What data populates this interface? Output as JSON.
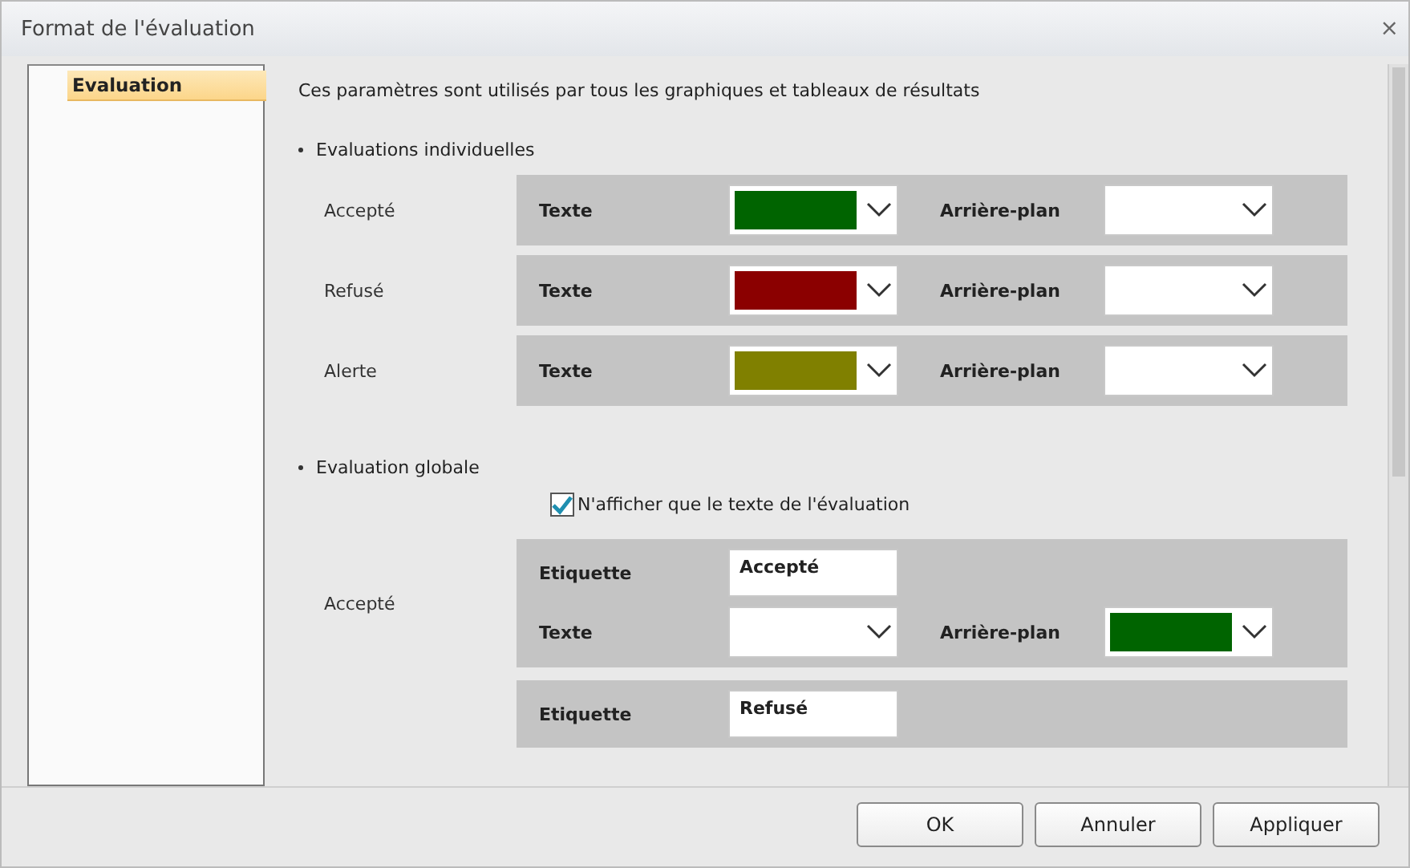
{
  "window": {
    "title": "Format de l'évaluation",
    "close": "×"
  },
  "sidebar": {
    "items": [
      {
        "label": "Evaluation",
        "selected": true
      }
    ]
  },
  "intro": "Ces paramètres sont utilisés par tous les graphiques et tableaux de résultats",
  "individual": {
    "heading": "Evaluations individuelles",
    "rows": [
      {
        "label": "Accepté",
        "text_label": "Texte",
        "text_picker": {
          "color": "#006400"
        },
        "background_label": "Arrière-plan",
        "background_picker": {
          "color": "#ffffff"
        }
      },
      {
        "label": "Refusé",
        "text_label": "Texte",
        "text_picker": {
          "color": "#8b0000"
        },
        "background_label": "Arrière-plan",
        "background_picker": {
          "color": "#ffffff"
        }
      },
      {
        "label": "Alerte",
        "text_label": "Texte",
        "text_picker": {
          "color": "#808000"
        },
        "background_label": "Arrière-plan",
        "background_picker": {
          "color": "#ffffff"
        }
      }
    ]
  },
  "global": {
    "heading": "Evaluation globale",
    "checkbox": {
      "label": "N'afficher que le texte de l'évaluation",
      "checked": true
    },
    "groups": [
      {
        "label": "Accepté",
        "etiquette_label": "Etiquette",
        "etiquette_value": "Accepté",
        "text_label": "Texte",
        "text_picker": {
          "color": "#ffffff"
        },
        "background_label": "Arrière-plan",
        "background_picker": {
          "color": "#006400"
        }
      },
      {
        "etiquette_label": "Etiquette",
        "etiquette_value": "Refusé"
      }
    ]
  },
  "buttons": [
    "OK",
    "Annuler",
    "Appliquer"
  ]
}
